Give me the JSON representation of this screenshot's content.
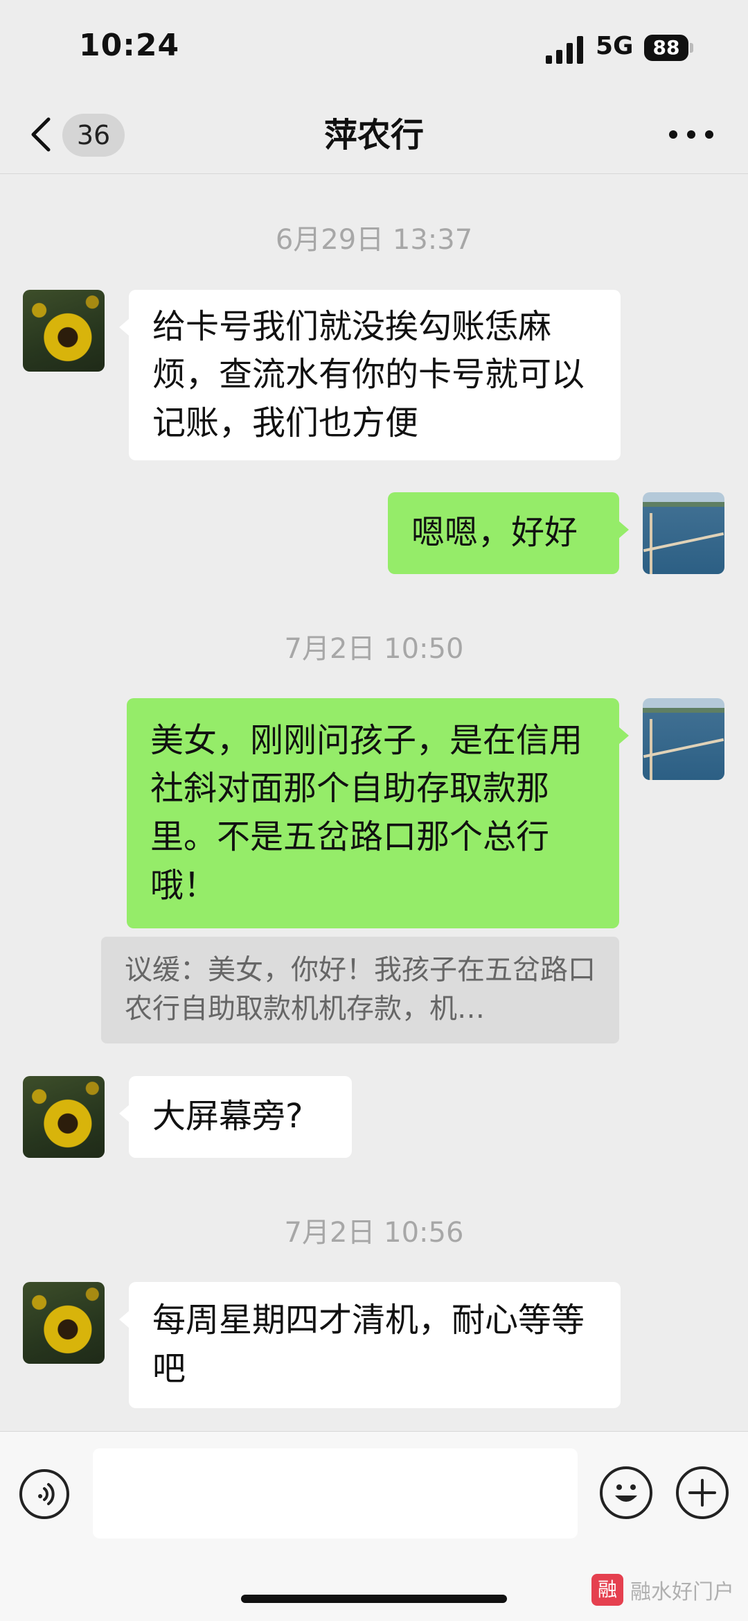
{
  "status_bar": {
    "time": "10:24",
    "network": "5G",
    "battery": "88"
  },
  "nav": {
    "unread_count": "36",
    "title": "萍农行"
  },
  "messages": [
    {
      "type": "timestamp",
      "text": "6月29日 13:37"
    },
    {
      "type": "incoming",
      "text": "给卡号我们就没挨勾账恁麻烦，查流水有你的卡号就可以记账，我们也方便"
    },
    {
      "type": "outgoing",
      "text": "嗯嗯，好好"
    },
    {
      "type": "timestamp",
      "text": "7月2日 10:50"
    },
    {
      "type": "outgoing",
      "text": "美女，刚刚问孩子，是在信用社斜对面那个自助存取款那里。不是五岔路口那个总行哦！"
    },
    {
      "type": "quote",
      "text": "议缓：美女，你好！我孩子在五岔路口农行自助取款机机存款，机…"
    },
    {
      "type": "incoming",
      "text": "大屏幕旁?"
    },
    {
      "type": "timestamp",
      "text": "7月2日 10:56"
    },
    {
      "type": "incoming",
      "text": "每周星期四才清机，耐心等等吧"
    }
  ],
  "input": {
    "placeholder": ""
  },
  "watermark": {
    "logo": "融",
    "text": "融水好门户"
  },
  "colors": {
    "background": "#ededed",
    "outgoing_bubble": "#95ec69",
    "incoming_bubble": "#ffffff",
    "timestamp": "#a7a7a7"
  },
  "icons": [
    "signal-icon",
    "battery-icon",
    "back-chevron-icon",
    "more-icon",
    "voice-icon",
    "emoji-icon",
    "plus-icon"
  ]
}
